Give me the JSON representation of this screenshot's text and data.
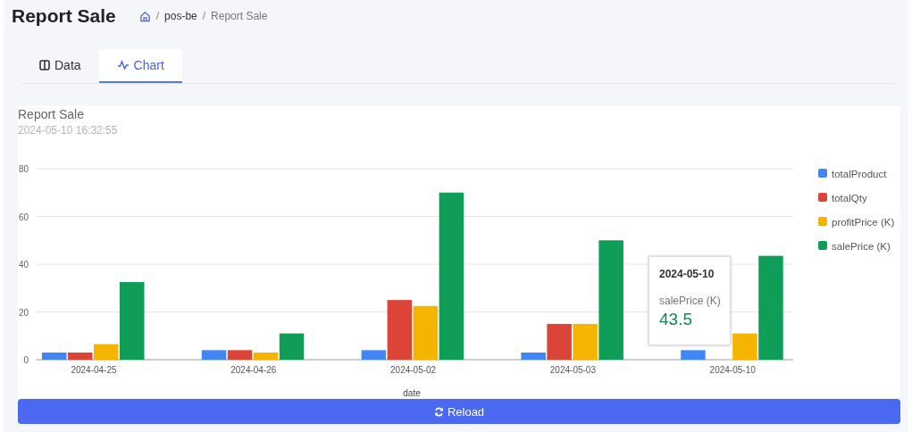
{
  "header": {
    "title": "Report Sale",
    "breadcrumb": [
      {
        "separator": "/",
        "label": "pos-be"
      },
      {
        "separator": "/",
        "label": "Report Sale"
      }
    ]
  },
  "tabs": [
    {
      "label": "Data",
      "selected": false
    },
    {
      "label": "Chart",
      "selected": true
    }
  ],
  "report": {
    "title": "Report Sale",
    "timestamp": "2024-05-10 16:32:55",
    "chart_data": {
      "type": "bar",
      "xlabel": "date",
      "categories": [
        "2024-04-25",
        "2024-04-26",
        "2024-05-02",
        "2024-05-03",
        "2024-05-10"
      ],
      "series": [
        {
          "name": "totalProduct",
          "color": "#4285f4",
          "values": [
            3,
            4,
            4,
            3,
            4
          ]
        },
        {
          "name": "totalQty",
          "color": "#db4437",
          "values": [
            3,
            4,
            25,
            15,
            null
          ]
        },
        {
          "name": "profitPrice (K)",
          "color": "#f4b400",
          "values": [
            6.5,
            3,
            22.5,
            15,
            11
          ]
        },
        {
          "name": "salePrice (K)",
          "color": "#0f9d58",
          "values": [
            32.5,
            11,
            70,
            50,
            43.5
          ]
        }
      ],
      "ylim": [
        0,
        80
      ],
      "yticks": [
        0,
        20,
        40,
        60,
        80
      ],
      "grid": true,
      "legend": true
    },
    "tooltip": {
      "title": "2024-05-10",
      "series": "salePrice (K)",
      "value": "43.5"
    }
  },
  "reload_button": {
    "label": "Reload"
  }
}
